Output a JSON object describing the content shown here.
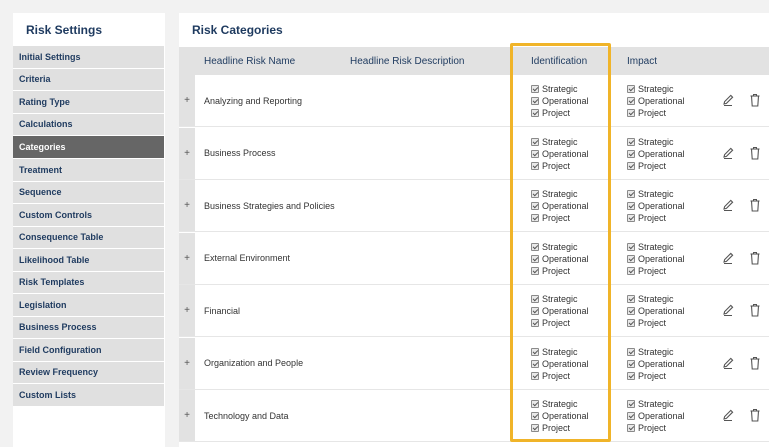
{
  "sidebar": {
    "title": "Risk Settings",
    "items": [
      {
        "label": "Initial Settings"
      },
      {
        "label": "Criteria"
      },
      {
        "label": "Rating Type"
      },
      {
        "label": "Calculations"
      },
      {
        "label": "Categories",
        "active": true
      },
      {
        "label": "Treatment"
      },
      {
        "label": "Sequence"
      },
      {
        "label": "Custom Controls"
      },
      {
        "label": "Consequence Table"
      },
      {
        "label": "Likelihood Table"
      },
      {
        "label": "Risk Templates"
      },
      {
        "label": "Legislation"
      },
      {
        "label": "Business Process"
      },
      {
        "label": "Field Configuration"
      },
      {
        "label": "Review Frequency"
      },
      {
        "label": "Custom Lists"
      }
    ]
  },
  "main": {
    "title": "Risk Categories",
    "columns": {
      "name": "Headline Risk Name",
      "description": "Headline Risk Description",
      "identification": "Identification",
      "impact": "Impact"
    },
    "check_labels": [
      "Strategic",
      "Operational",
      "Project"
    ],
    "rows": [
      {
        "name": "Analyzing and Reporting"
      },
      {
        "name": "Business Process"
      },
      {
        "name": "Business Strategies and Policies"
      },
      {
        "name": "External Environment"
      },
      {
        "name": "Financial"
      },
      {
        "name": "Organization and People"
      },
      {
        "name": "Technology and Data"
      }
    ],
    "expand_glyph": "+"
  },
  "icons": {
    "edit": "pencil-icon",
    "delete": "trash-icon"
  },
  "colors": {
    "highlight": "#f0b429",
    "heading": "#1e3a5f",
    "active_nav": "#666666",
    "row_header": "#e2e2e2"
  }
}
